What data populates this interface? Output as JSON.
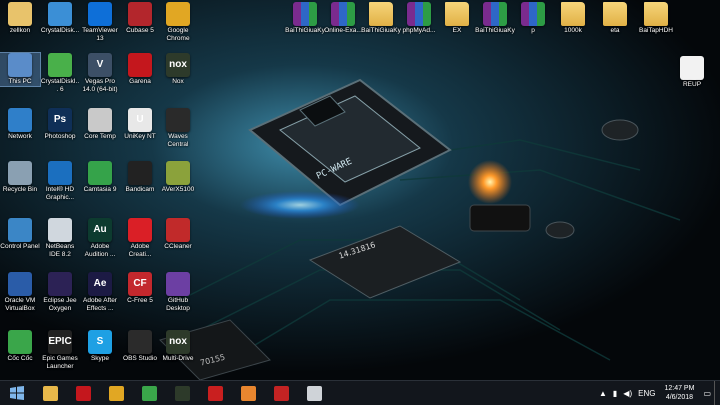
{
  "desktop": {
    "col1": [
      {
        "label": "zellkon",
        "icon": "user-folder-icon",
        "color": "#e8c36b"
      },
      {
        "label": "This PC",
        "icon": "computer-icon",
        "color": "#5a8cc9",
        "selected": true
      },
      {
        "label": "Network",
        "icon": "network-icon",
        "color": "#2f7fc9"
      },
      {
        "label": "Recycle Bin",
        "icon": "recycle-bin-icon",
        "color": "#8aa0b2"
      },
      {
        "label": "Control Panel",
        "icon": "control-panel-icon",
        "color": "#3b86c6"
      },
      {
        "label": "Oracle VM VirtualBox",
        "icon": "virtualbox-icon",
        "color": "#2a5ca8"
      },
      {
        "label": "Cốc Cốc",
        "icon": "coccoc-icon",
        "color": "#3aa64a"
      }
    ],
    "col2": [
      {
        "label": "CrystalDisk...",
        "icon": "crystaldisk-icon",
        "color": "#3b8fd6"
      },
      {
        "label": "CrystalDiskI... 6",
        "icon": "crystaldiskinfo-icon",
        "color": "#49b04a"
      },
      {
        "label": "Photoshop",
        "icon": "photoshop-icon",
        "color": "#0f2f57",
        "text": "Ps"
      },
      {
        "label": "Intel® HD Graphic...",
        "icon": "intel-graphics-icon",
        "color": "#1b6fbf"
      },
      {
        "label": "NetBeans IDE 8.2",
        "icon": "netbeans-icon",
        "color": "#d0d7de"
      },
      {
        "label": "Eclipse Jee Oxygen",
        "icon": "eclipse-icon",
        "color": "#2c2255"
      },
      {
        "label": "Epic Games Launcher",
        "icon": "epic-games-icon",
        "color": "#222",
        "text": "EPIC"
      }
    ],
    "col3": [
      {
        "label": "TeamViewer 13",
        "icon": "teamviewer-icon",
        "color": "#0e6fd8"
      },
      {
        "label": "Vegas Pro 14.0 (64-bit)",
        "icon": "vegas-icon",
        "color": "#3c4f66",
        "text": "V"
      },
      {
        "label": "Core Temp",
        "icon": "core-temp-icon",
        "color": "#c9c9c9"
      },
      {
        "label": "Camtasia 9",
        "icon": "camtasia-icon",
        "color": "#35a34a"
      },
      {
        "label": "Adobe Audition ...",
        "icon": "audition-icon",
        "color": "#0d3b2f",
        "text": "Au"
      },
      {
        "label": "Adobe After Effects ...",
        "icon": "after-effects-icon",
        "color": "#1c1a44",
        "text": "Ae"
      },
      {
        "label": "Skype",
        "icon": "skype-icon",
        "color": "#1ea0e4",
        "text": "S"
      }
    ],
    "col4": [
      {
        "label": "Cubase 5",
        "icon": "cubase-icon",
        "color": "#b3262c"
      },
      {
        "label": "Garena",
        "icon": "garena-icon",
        "color": "#c4171d"
      },
      {
        "label": "UniKey NT",
        "icon": "unikey-icon",
        "color": "#e8e8e8",
        "text": "U"
      },
      {
        "label": "Bandicam",
        "icon": "bandicam-icon",
        "color": "#222"
      },
      {
        "label": "Adobe Creati...",
        "icon": "creative-cloud-icon",
        "color": "#da1f26"
      },
      {
        "label": "C-Free 5",
        "icon": "cfree-icon",
        "color": "#c3282d",
        "text": "CF"
      },
      {
        "label": "OBS Studio",
        "icon": "obs-icon",
        "color": "#2b2b2b"
      }
    ],
    "col5": [
      {
        "label": "Google Chrome",
        "icon": "chrome-icon",
        "color": "#e1a723"
      },
      {
        "label": "Nox",
        "icon": "nox-icon",
        "color": "#2d3a2a",
        "text": "nox"
      },
      {
        "label": "Waves Central",
        "icon": "waves-icon",
        "color": "#2a2a2a"
      },
      {
        "label": "AVerX5100",
        "icon": "aver-icon",
        "color": "#8ba23b"
      },
      {
        "label": "CCleaner",
        "icon": "ccleaner-icon",
        "color": "#c12a2a"
      },
      {
        "label": "GitHub Desktop",
        "icon": "github-icon",
        "color": "#6c3fa3"
      },
      {
        "label": "Multi-Drive",
        "icon": "multi-drive-icon",
        "color": "#2d3a2a",
        "text": "nox"
      }
    ],
    "top_row": [
      {
        "label": "BaiThiGiuaKy",
        "icon": "rar-archive-icon",
        "kind": "rar"
      },
      {
        "label": "Online-Exa...",
        "icon": "rar-archive-icon",
        "kind": "rar"
      },
      {
        "label": "BaiThiGiuaKy",
        "icon": "folder-icon",
        "kind": "folder"
      },
      {
        "label": "phpMyAd...",
        "icon": "rar-archive-icon",
        "kind": "rar"
      },
      {
        "label": "EX",
        "icon": "folder-icon",
        "kind": "folder"
      },
      {
        "label": "BaiThiGiuaKy",
        "icon": "rar-archive-icon",
        "kind": "rar"
      },
      {
        "label": "p",
        "icon": "rar-archive-icon",
        "kind": "rar"
      },
      {
        "label": "1000k",
        "icon": "folder-icon",
        "kind": "folder"
      },
      {
        "label": "eta",
        "icon": "folder-icon",
        "kind": "folder"
      },
      {
        "label": "BaiTapHDH",
        "icon": "folder-icon",
        "kind": "folder"
      }
    ],
    "right_col": [
      {
        "label": "REUP",
        "icon": "file-icon",
        "kind": "file"
      }
    ],
    "wallpaper_chip_text": "PC-WARE",
    "wallpaper_chip2_text": "14.31816",
    "wallpaper_chip3_text": "70155"
  },
  "taskbar": {
    "start": {
      "icon": "windows-start-icon"
    },
    "apps": [
      {
        "icon": "file-explorer-icon",
        "color": "#e8b84a"
      },
      {
        "icon": "garena-icon",
        "color": "#c4171d"
      },
      {
        "icon": "chrome-icon",
        "color": "#e1a723"
      },
      {
        "icon": "coccoc-icon",
        "color": "#3aa64a"
      },
      {
        "icon": "nox-icon",
        "color": "#2d3a2a"
      },
      {
        "icon": "acrobat-icon",
        "color": "#c91f1f"
      },
      {
        "icon": "media-player-icon",
        "color": "#e8862f"
      },
      {
        "icon": "camtasia-icon",
        "color": "#c32323"
      },
      {
        "icon": "window-icon",
        "color": "#cfd3d8"
      }
    ],
    "tray": {
      "language": "ENG",
      "time": "12:47 PM",
      "date": "4/6/2018"
    }
  }
}
